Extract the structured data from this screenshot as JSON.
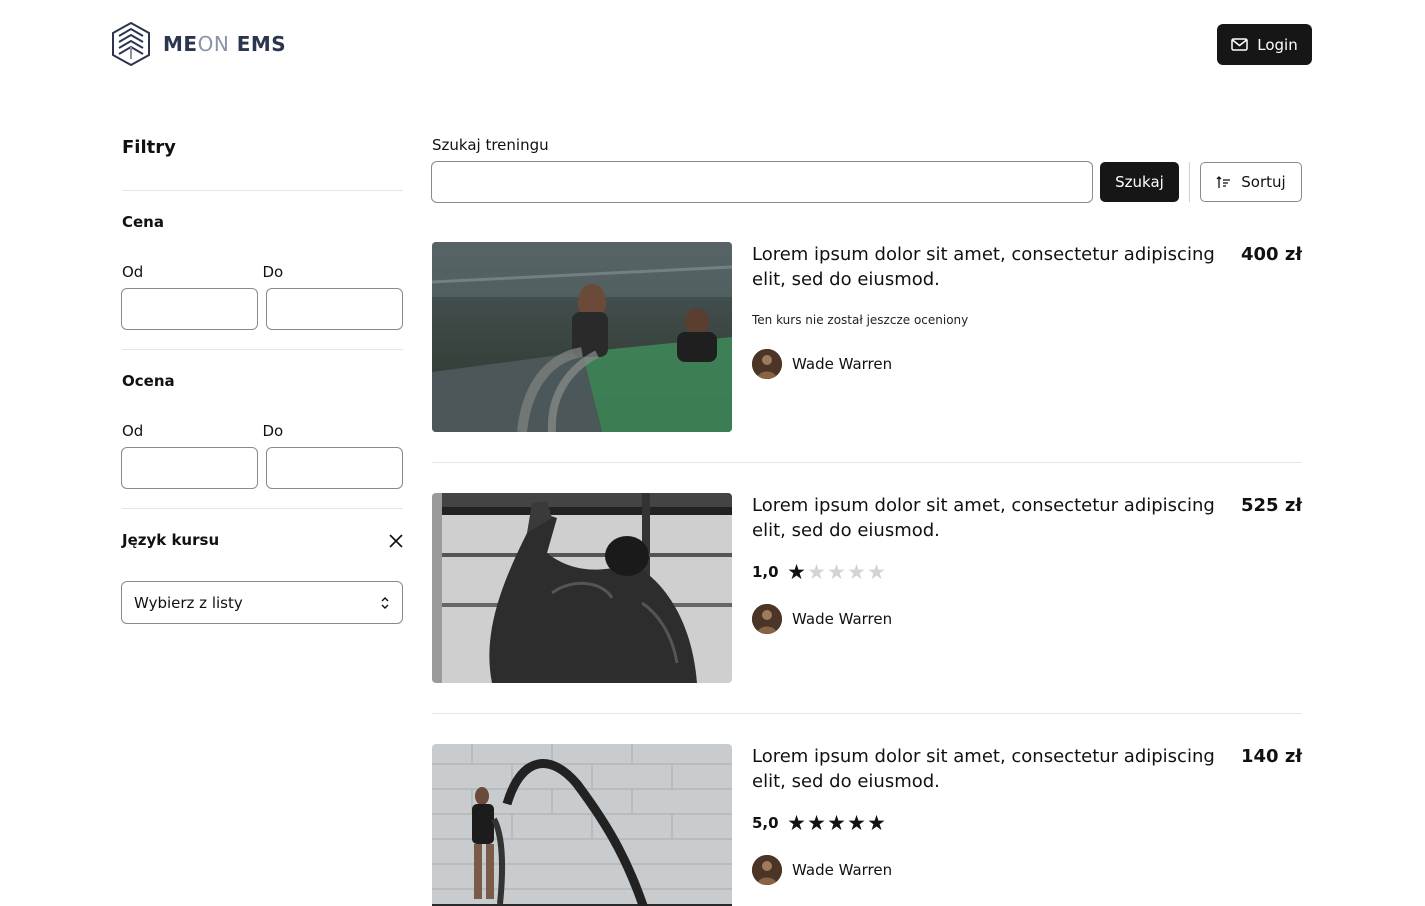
{
  "brand": {
    "name_part1": "ME",
    "name_part2": "ON",
    "name_part3": " EMS"
  },
  "header": {
    "login_label": "Login"
  },
  "filters": {
    "title": "Filtry",
    "price": {
      "title": "Cena",
      "from_label": "Od",
      "to_label": "Do"
    },
    "rating": {
      "title": "Ocena",
      "from_label": "Od",
      "to_label": "Do"
    },
    "language": {
      "title": "Język kursu",
      "select_placeholder": "Wybierz z listy"
    }
  },
  "search": {
    "label": "Szukaj treningu",
    "value": "",
    "button_label": "Szukaj",
    "sort_label": "Sortuj"
  },
  "courses": [
    {
      "title": "Lorem ipsum dolor sit amet, consectetur adipiscing elit, sed do eiusmod.",
      "price": "400 zł",
      "rating_text": "Ten kurs nie został jeszcze oceniony",
      "author": "Wade Warren"
    },
    {
      "title": "Lorem ipsum dolor sit amet, consectetur adipiscing elit, sed do eiusmod.",
      "price": "525 zł",
      "rating": "1,0",
      "stars": 1,
      "author": "Wade Warren"
    },
    {
      "title": "Lorem ipsum dolor sit amet, consectetur adipiscing elit, sed do eiusmod.",
      "price": "140 zł",
      "rating": "5,0",
      "stars": 5,
      "author": "Wade Warren"
    }
  ],
  "colors": {
    "primary_button": "#161616",
    "brand_dark": "#2c3550",
    "brand_light": "#8a93a8",
    "star_on": "#111111",
    "star_off": "#d4d4d4"
  }
}
